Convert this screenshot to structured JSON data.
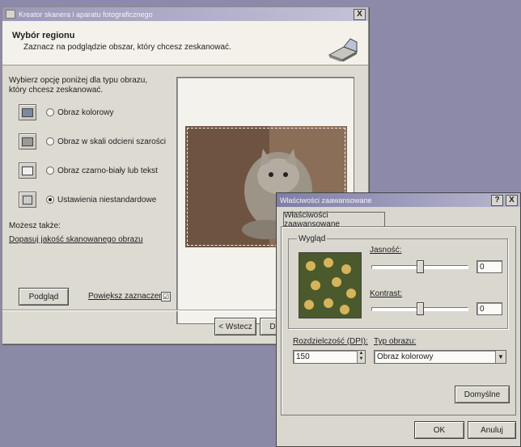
{
  "wizard": {
    "title": "Kreator skanera i aparatu fotograficznego",
    "header_title": "Wybór regionu",
    "header_subtitle": "Zaznacz na podglądzie obszar, który chcesz zeskanować.",
    "prompt": "Wybierz opcję poniżej dla typu obrazu, który chcesz zeskanować.",
    "options": [
      {
        "label": "Obraz kolorowy",
        "selected": false
      },
      {
        "label": "Obraz w skali odcieni szarości",
        "selected": false
      },
      {
        "label": "Obraz czarno-biały lub tekst",
        "selected": false
      },
      {
        "label": "Ustawienia niestandardowe",
        "selected": true
      }
    ],
    "also_label": "Możesz także:",
    "adjust_link": "Dopasuj jakość skanowanego obrazu",
    "preview_button": "Podgląd",
    "enlarge_label": "Powiększ zaznaczenie",
    "enlarge_checked": "☑",
    "back_button": "< Wstecz",
    "next_button_partial": "D"
  },
  "advanced": {
    "title": "Właściwości zaawansowane",
    "tab_label": "Właściwości zaawansowane",
    "group_label": "Wygląd",
    "brightness_label": "Jasność:",
    "brightness_value": "0",
    "contrast_label": "Kontrast:",
    "contrast_value": "0",
    "resolution_label": "Rozdzielczość (DPI):",
    "resolution_value": "150",
    "type_label": "Typ obrazu:",
    "type_value": "Obraz kolorowy",
    "defaults_button": "Domyślne",
    "ok_button": "OK",
    "cancel_button": "Anuluj",
    "help_button": "?",
    "close_button": "X"
  },
  "wizard_close_button": "X"
}
